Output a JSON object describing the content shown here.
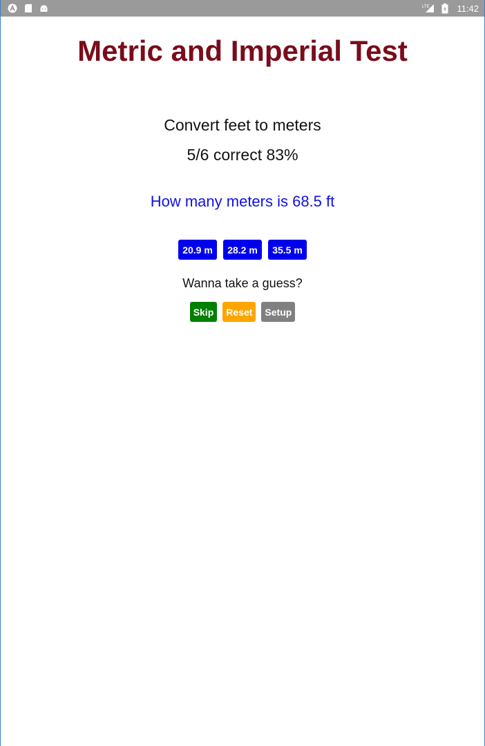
{
  "status_bar": {
    "time": "11:42",
    "left_icons": [
      "app-a-icon",
      "sd-card-icon",
      "android-icon"
    ],
    "right_icons": [
      "lte-signal-icon",
      "battery-icon"
    ]
  },
  "app": {
    "title": "Metric and Imperial Test",
    "subtitle": "Convert feet to meters",
    "score": "5/6 correct 83%",
    "question": "How many meters is 68.5 ft",
    "answers": [
      "20.9 m",
      "28.2 m",
      "35.5 m"
    ],
    "prompt": "Wanna take a guess?",
    "controls": {
      "skip": "Skip",
      "reset": "Reset",
      "setup": "Setup"
    }
  },
  "colors": {
    "title": "#7a0c1b",
    "question": "#1010e8",
    "answer_button": "#0000ee",
    "skip_button": "#008000",
    "reset_button": "#ffa500",
    "setup_button": "#808080",
    "status_bar": "#9a9a9a"
  }
}
